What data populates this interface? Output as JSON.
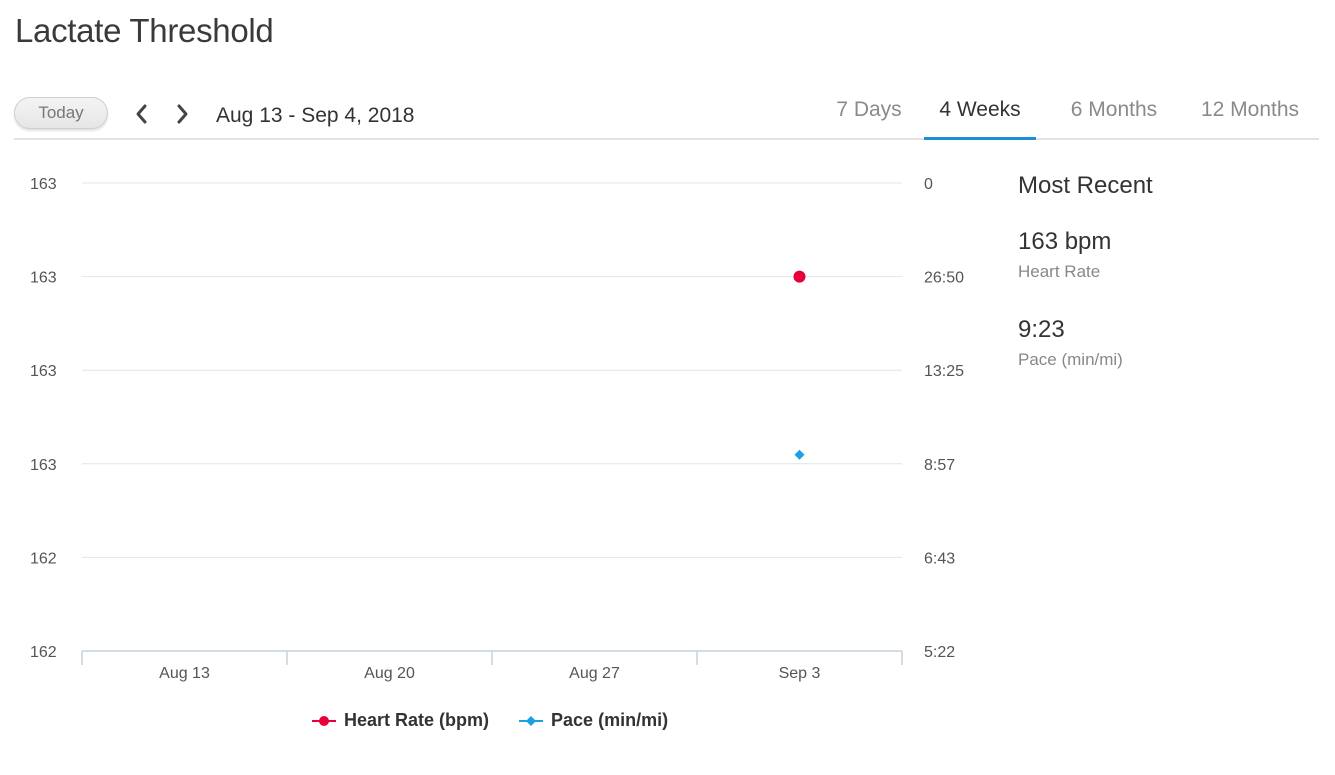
{
  "page": {
    "title": "Lactate Threshold"
  },
  "toolbar": {
    "today_label": "Today",
    "date_range": "Aug 13 - Sep 4, 2018",
    "tabs": [
      {
        "label": "7 Days",
        "active": false
      },
      {
        "label": "4 Weeks",
        "active": true
      },
      {
        "label": "6 Months",
        "active": false
      },
      {
        "label": "12 Months",
        "active": false
      }
    ]
  },
  "colors": {
    "heart_rate": "#e8003d",
    "pace": "#1ba1e2",
    "active_tab": "#1a8fd6"
  },
  "icons": {
    "prev": "chevron-left-icon",
    "next": "chevron-right-icon"
  },
  "chart_data": {
    "type": "scatter",
    "x_ticks": [
      "Aug 13",
      "Aug 20",
      "Aug 27",
      "Sep 3"
    ],
    "left_axis_ticks": [
      "163",
      "163",
      "163",
      "163",
      "162",
      "162"
    ],
    "right_axis_ticks": [
      "0",
      "26:50",
      "13:25",
      "8:57",
      "6:43",
      "5:22"
    ],
    "grid": true,
    "legend_position": "bottom",
    "series": [
      {
        "name": "Heart Rate (bpm)",
        "axis": "left",
        "marker": "circle",
        "points": [
          {
            "x": "Sep 3",
            "y": 163
          }
        ]
      },
      {
        "name": "Pace (min/mi)",
        "axis": "right",
        "marker": "diamond",
        "points": [
          {
            "x": "Sep 3",
            "y": "9:23"
          }
        ]
      }
    ]
  },
  "most_recent": {
    "title": "Most Recent",
    "items": [
      {
        "value": "163 bpm",
        "label": "Heart Rate"
      },
      {
        "value": "9:23",
        "label": "Pace (min/mi)"
      }
    ]
  }
}
